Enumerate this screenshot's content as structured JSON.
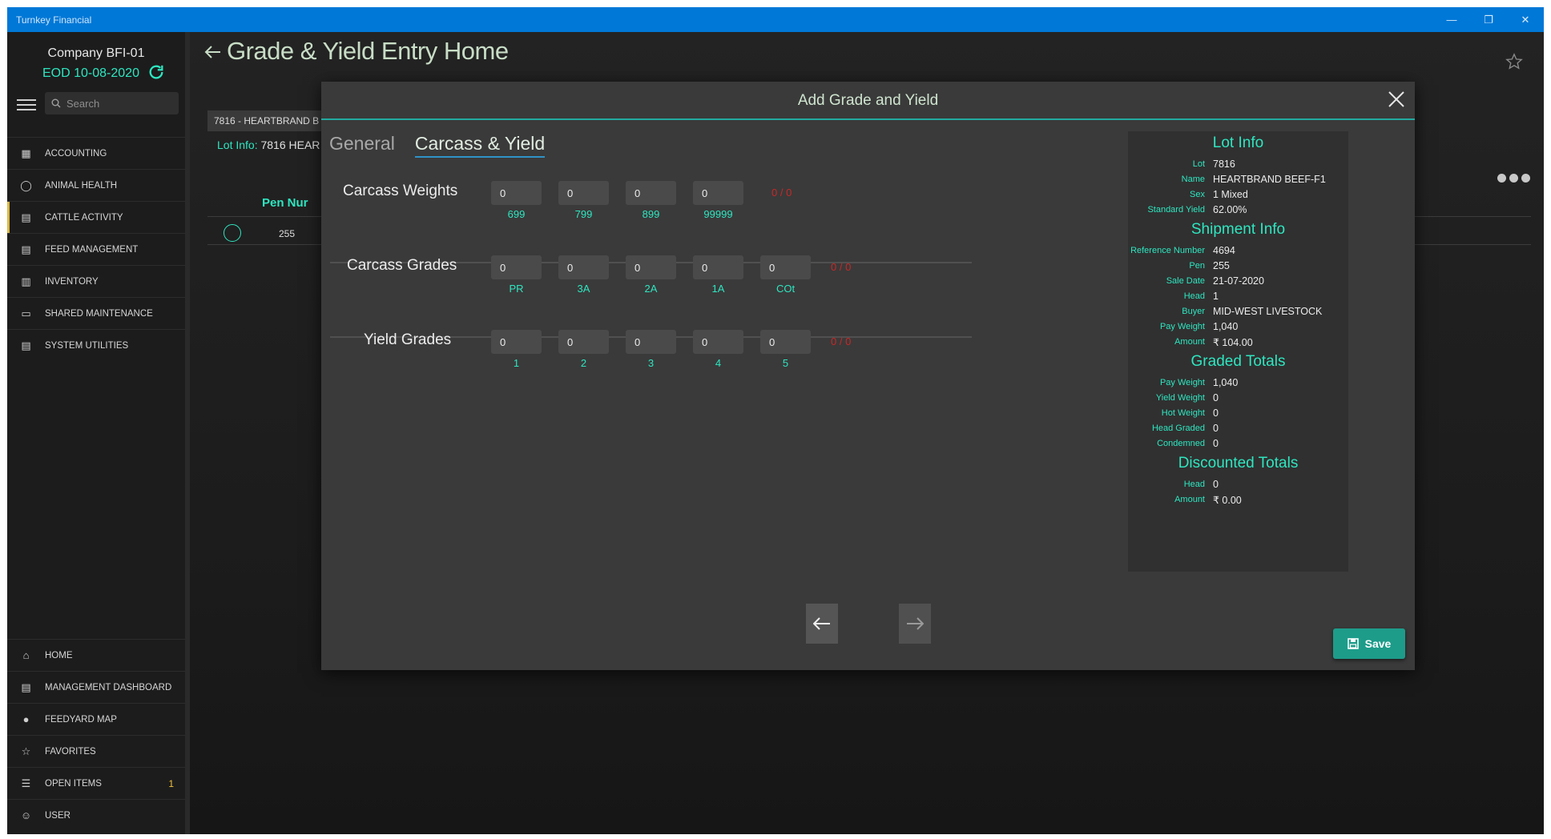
{
  "window": {
    "title": "Turnkey Financial"
  },
  "sidebar": {
    "company": "Company BFI-01",
    "eod": "EOD 10-08-2020",
    "search_placeholder": "Search",
    "nav_top": [
      {
        "label": "ACCOUNTING",
        "icon": "bank-icon"
      },
      {
        "label": "ANIMAL HEALTH",
        "icon": "tag-icon"
      },
      {
        "label": "CATTLE ACTIVITY",
        "icon": "cattle-icon"
      },
      {
        "label": "FEED MANAGEMENT",
        "icon": "list-icon"
      },
      {
        "label": "INVENTORY",
        "icon": "clipboard-icon"
      },
      {
        "label": "SHARED MAINTENANCE",
        "icon": "monitor-icon"
      },
      {
        "label": "SYSTEM UTILITIES",
        "icon": "utility-icon"
      }
    ],
    "nav_bottom": [
      {
        "label": "HOME",
        "icon": "home-icon"
      },
      {
        "label": "MANAGEMENT DASHBOARD",
        "icon": "dashboard-icon"
      },
      {
        "label": "FEEDYARD MAP",
        "icon": "globe-icon"
      },
      {
        "label": "FAVORITES",
        "icon": "star-icon"
      },
      {
        "label": "OPEN ITEMS",
        "icon": "stack-icon",
        "badge": "1"
      },
      {
        "label": "USER",
        "icon": "user-icon"
      }
    ]
  },
  "page": {
    "title": "Grade & Yield Entry Home",
    "lot_tab": "7816 - HEARTBRAND B",
    "lot_info_label": "Lot Info:",
    "lot_info_value": "7816  HEAR",
    "pen_header": "Pen Nur",
    "pen_value": "255"
  },
  "dialog": {
    "title": "Add Grade and Yield",
    "tabs": [
      "General",
      "Carcass & Yield"
    ],
    "active_tab": "Carcass & Yield",
    "carcass_weights": {
      "label": "Carcass Weights",
      "values": [
        "0",
        "0",
        "0",
        "0"
      ],
      "labels": [
        "699",
        "799",
        "899",
        "99999"
      ],
      "ratio": "0 / 0"
    },
    "carcass_grades": {
      "label": "Carcass Grades",
      "values": [
        "0",
        "0",
        "0",
        "0",
        "0"
      ],
      "labels": [
        "PR",
        "3A",
        "2A",
        "1A",
        "COt"
      ],
      "ratio": "0 / 0"
    },
    "yield_grades": {
      "label": "Yield Grades",
      "values": [
        "0",
        "0",
        "0",
        "0",
        "0"
      ],
      "labels": [
        "1",
        "2",
        "3",
        "4",
        "5"
      ],
      "ratio": "0 / 0"
    },
    "save_label": "Save",
    "lot_info": {
      "heading": "Lot Info",
      "rows": [
        {
          "k": "Lot",
          "v": "7816"
        },
        {
          "k": "Name",
          "v": "HEARTBRAND BEEF-F1"
        },
        {
          "k": "Sex",
          "v": "1 Mixed"
        },
        {
          "k": "Standard Yield",
          "v": "62.00%"
        }
      ]
    },
    "shipment_info": {
      "heading": "Shipment Info",
      "rows": [
        {
          "k": "Reference Number",
          "v": "4694"
        },
        {
          "k": "Pen",
          "v": "255"
        },
        {
          "k": "Sale Date",
          "v": "21-07-2020"
        },
        {
          "k": "Head",
          "v": "1"
        },
        {
          "k": "Buyer",
          "v": "MID-WEST LIVESTOCK"
        },
        {
          "k": "Pay Weight",
          "v": "1,040"
        },
        {
          "k": "Amount",
          "v": "₹ 104.00"
        }
      ]
    },
    "graded_totals": {
      "heading": "Graded Totals",
      "rows": [
        {
          "k": "Pay Weight",
          "v": "1,040"
        },
        {
          "k": "Yield Weight",
          "v": "0"
        },
        {
          "k": "Hot Weight",
          "v": "0"
        },
        {
          "k": "Head Graded",
          "v": "0"
        },
        {
          "k": "Condemned",
          "v": "0"
        }
      ]
    },
    "discounted_totals": {
      "heading": "Discounted Totals",
      "rows": [
        {
          "k": "Head",
          "v": "0"
        },
        {
          "k": "Amount",
          "v": "₹ 0.00"
        }
      ]
    }
  }
}
